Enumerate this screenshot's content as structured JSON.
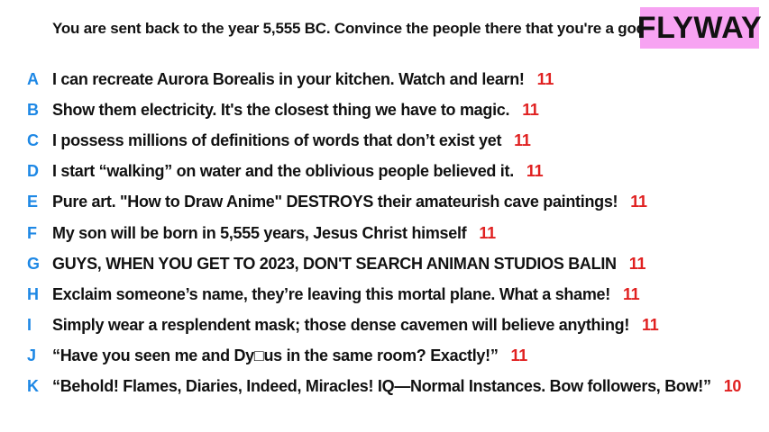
{
  "prompt": "You are sent back to the year 5,555 BC. Convince the people there that you're a god.",
  "logo": "FLYWAY",
  "colors": {
    "letter": "#1e88e5",
    "score": "#e02020",
    "logo_bg": "#f7a3f2",
    "text": "#111111"
  },
  "answers": [
    {
      "letter": "A",
      "text": "I can recreate Aurora Borealis in your kitchen. Watch and learn!",
      "score": "11"
    },
    {
      "letter": "B",
      "text": "Show them electricity. It's the closest thing we have to magic.",
      "score": "11"
    },
    {
      "letter": "C",
      "text": "I possess millions of definitions of words that don’t exist yet",
      "score": "11"
    },
    {
      "letter": "D",
      "text": "I start “walking” on water and the oblivious people believed it.",
      "score": "11"
    },
    {
      "letter": "E",
      "text": "Pure art. \"How to Draw Anime\" DESTROYS their amateurish cave paintings!",
      "score": "11"
    },
    {
      "letter": "F",
      "text": "My son will be born in 5,555 years, Jesus Christ himself",
      "score": "11"
    },
    {
      "letter": "G",
      "text": "GUYS, WHEN YOU GET TO 2023, DON'T SEARCH ANIMAN STUDIOS BALIN",
      "score": "11"
    },
    {
      "letter": "H",
      "text": "Exclaim someone’s name, they’re leaving this mortal plane. What a shame!",
      "score": "11"
    },
    {
      "letter": "I",
      "text": "Simply wear a resplendent mask; those dense cavemen will believe anything!",
      "score": "11"
    },
    {
      "letter": "J",
      "text": "“Have you seen me and Dy□us in the same room? Exactly!”",
      "score": "11"
    },
    {
      "letter": "K",
      "text": "“Behold! Flames, Diaries, Indeed, Miracles! IQ—Normal Instances. Bow followers, Bow!”",
      "score": "10"
    }
  ]
}
